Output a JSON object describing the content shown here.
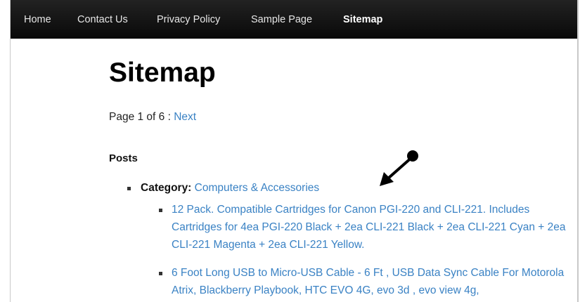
{
  "nav": {
    "items": [
      {
        "label": "Home"
      },
      {
        "label": "Contact Us"
      },
      {
        "label": "Privacy Policy"
      },
      {
        "label": "Sample Page"
      },
      {
        "label": "Sitemap"
      }
    ],
    "active": "Sitemap"
  },
  "page": {
    "title": "Sitemap",
    "pager_text": "Page 1 of 6 : ",
    "next_label": "Next"
  },
  "posts": {
    "heading": "Posts",
    "category_label": "Category:",
    "category_name": "Computers & Accessories",
    "items": [
      {
        "title": "12 Pack. Compatible Cartridges for Canon PGI-220 and CLI-221. Includes Cartridges for 4ea PGI-220 Black + 2ea CLI-221 Black + 2ea CLI-221 Cyan + 2ea CLI-221 Magenta + 2ea CLI-221 Yellow."
      },
      {
        "title": "6 Foot Long USB to Micro-USB Cable - 6 Ft , USB Data Sync Cable For Motorola Atrix, Blackberry Playbook, HTC EVO 4G, evo 3d , evo view 4g,"
      }
    ]
  },
  "annotation": {
    "icon": "pointer-arrow-icon",
    "color": "#000000"
  },
  "colors": {
    "link": "#3a82c4",
    "navbar": "#111111",
    "nav_text": "#e6e6e6"
  }
}
